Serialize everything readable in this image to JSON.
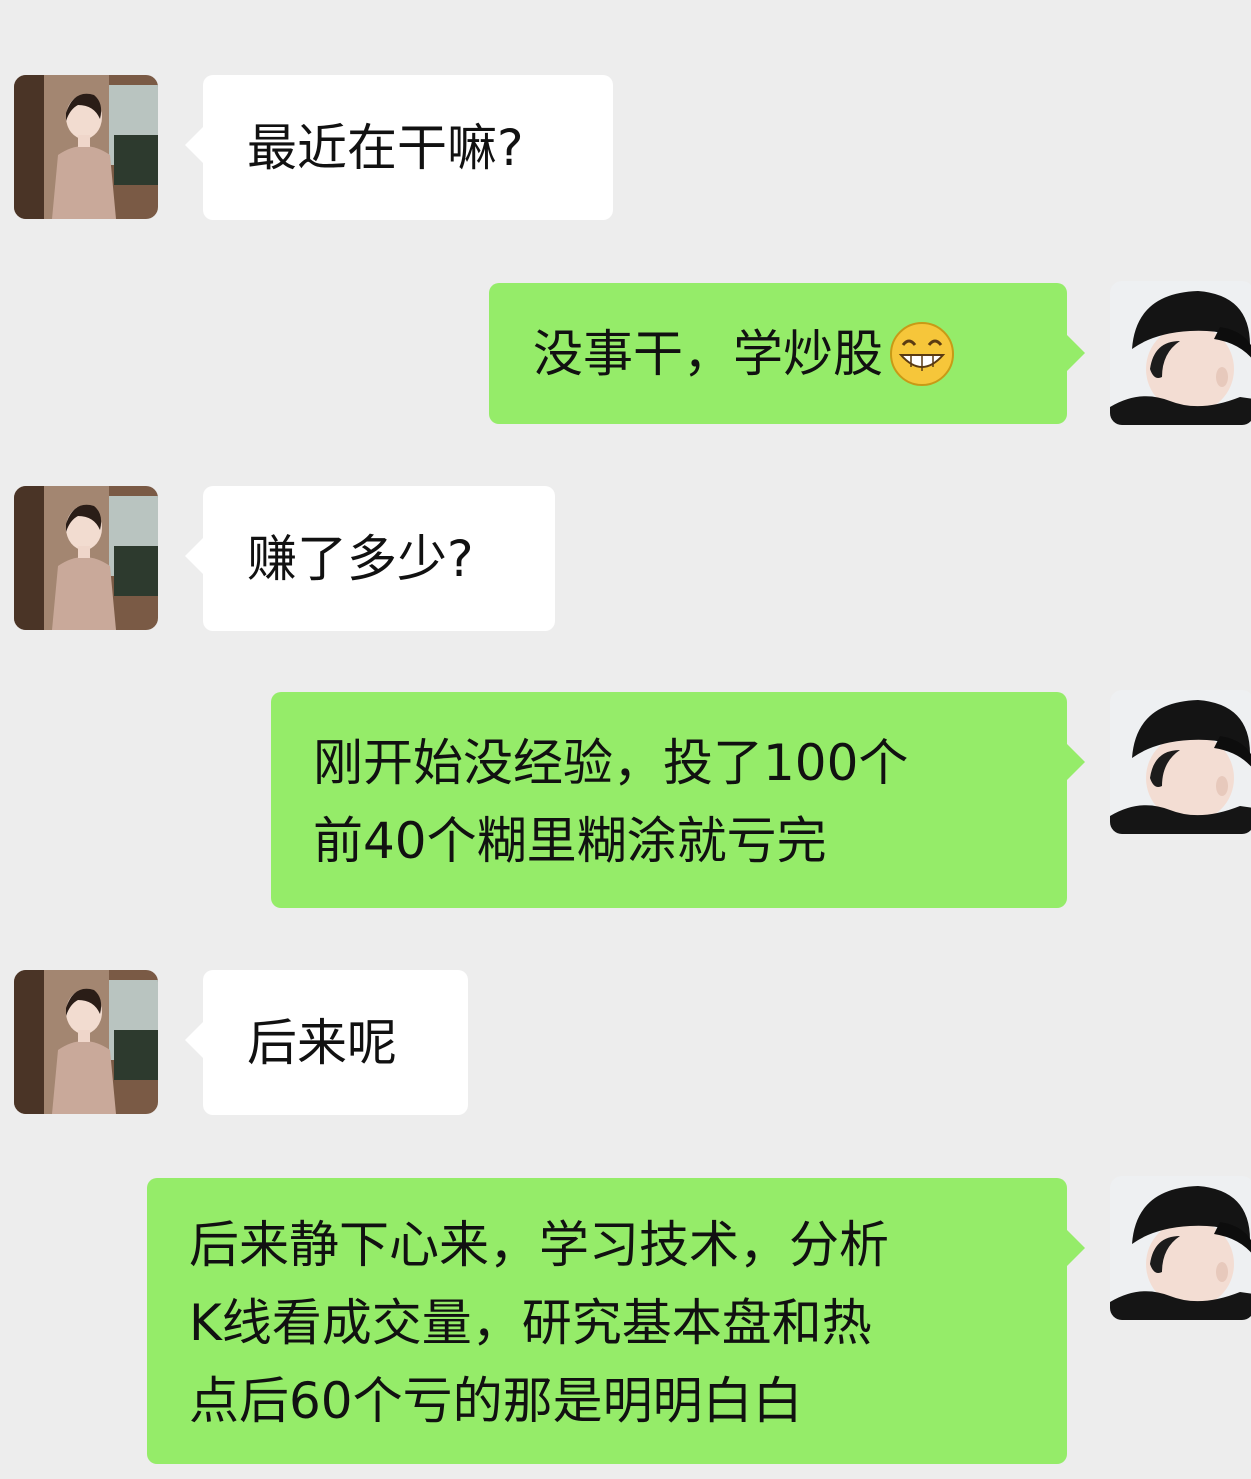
{
  "messages": [
    {
      "side": "left",
      "text": "最近在干嘛?"
    },
    {
      "side": "right",
      "text": "没事干，学炒股",
      "emoji": "grinning-face-emoji"
    },
    {
      "side": "left",
      "text": "赚了多少?"
    },
    {
      "side": "right",
      "lines": [
        "刚开始没经验，投了100个",
        "前40个糊里糊涂就亏完"
      ]
    },
    {
      "side": "left",
      "text": "后来呢"
    },
    {
      "side": "right",
      "lines": [
        "后来静下心来，学习技术，分析",
        "K线看成交量，研究基本盘和热",
        "点后60个亏的那是明明白白"
      ]
    }
  ],
  "colors": {
    "background": "#ededed",
    "incoming_bubble": "#ffffff",
    "outgoing_bubble": "#95ec69"
  },
  "icons": {
    "incoming_avatar": "woman-avatar",
    "outgoing_avatar": "man-in-cap-avatar"
  }
}
